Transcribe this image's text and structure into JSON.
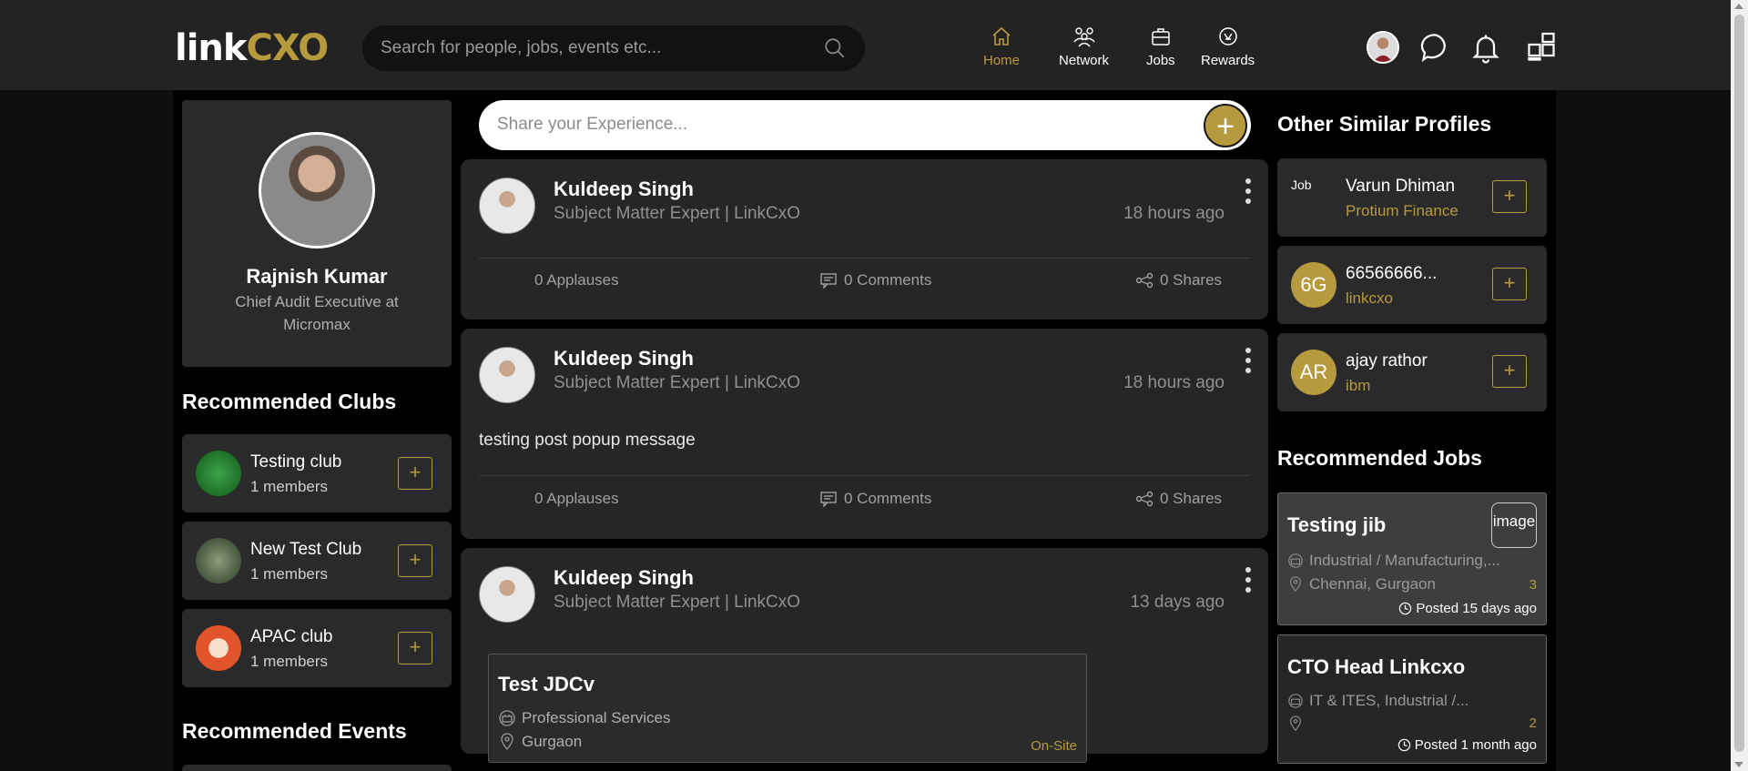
{
  "header": {
    "logo_main": "link",
    "logo_accent": "CXO",
    "search_placeholder": "Search for people, jobs, events etc...",
    "nav": [
      {
        "label": "Home",
        "icon": "home-icon",
        "active": true
      },
      {
        "label": "Network",
        "icon": "network-icon",
        "active": false
      },
      {
        "label": "Jobs",
        "icon": "briefcase-icon",
        "active": false
      },
      {
        "label": "Rewards",
        "icon": "rewards-icon",
        "active": false
      }
    ],
    "accent_color": "#b89a3e"
  },
  "profile": {
    "name": "Rajnish Kumar",
    "title": "Chief Audit Executive at Micromax"
  },
  "clubs": {
    "heading": "Recommended Clubs",
    "items": [
      {
        "name": "Testing club",
        "members": "1 members",
        "color": "#1f7a2a"
      },
      {
        "name": "New Test Club",
        "members": "1 members",
        "color": "#4a5a3a"
      },
      {
        "name": "APAC club",
        "members": "1 members",
        "color": "#e0552a"
      }
    ]
  },
  "events": {
    "heading": "Recommended Events"
  },
  "feed": {
    "share_placeholder": "Share your Experience...",
    "share_add": "+",
    "posts": [
      {
        "author": "Kuldeep Singh",
        "role": "Subject Matter Expert | LinkCxO",
        "time": "18 hours ago",
        "applauses": "0 Applauses",
        "comments": "0 Comments",
        "shares": "0 Shares"
      },
      {
        "author": "Kuldeep Singh",
        "role": "Subject Matter Expert | LinkCxO",
        "time": "18 hours ago",
        "body": "testing post popup message",
        "applauses": "0 Applauses",
        "comments": "0 Comments",
        "shares": "0 Shares"
      },
      {
        "author": "Kuldeep Singh",
        "role": "Subject Matter Expert | LinkCxO",
        "time": "13 days ago",
        "job": {
          "title": "Test JDCv",
          "industry": "Professional Services",
          "location": "Gurgaon",
          "type": "On-Site"
        }
      }
    ]
  },
  "similar": {
    "heading": "Other Similar Profiles",
    "items": [
      {
        "initials": "Job",
        "name": "Varun Dhiman",
        "company": "Protium Finance"
      },
      {
        "initials": "6G",
        "name": "66566666...",
        "company": "linkcxo"
      },
      {
        "initials": "AR",
        "name": "ajay rathor",
        "company": "ibm"
      }
    ]
  },
  "jobs": {
    "heading": "Recommended Jobs",
    "items": [
      {
        "title": "Testing jib",
        "image_alt": "image",
        "industry": "Industrial / Manufacturing,...",
        "location": "Chennai, Gurgaon",
        "count": "3",
        "posted": "Posted 15 days ago"
      },
      {
        "title": "CTO Head Linkcxo",
        "industry": "IT & ITES, Industrial /...",
        "location": "",
        "count": "2",
        "posted": "Posted 1 month ago"
      }
    ]
  }
}
